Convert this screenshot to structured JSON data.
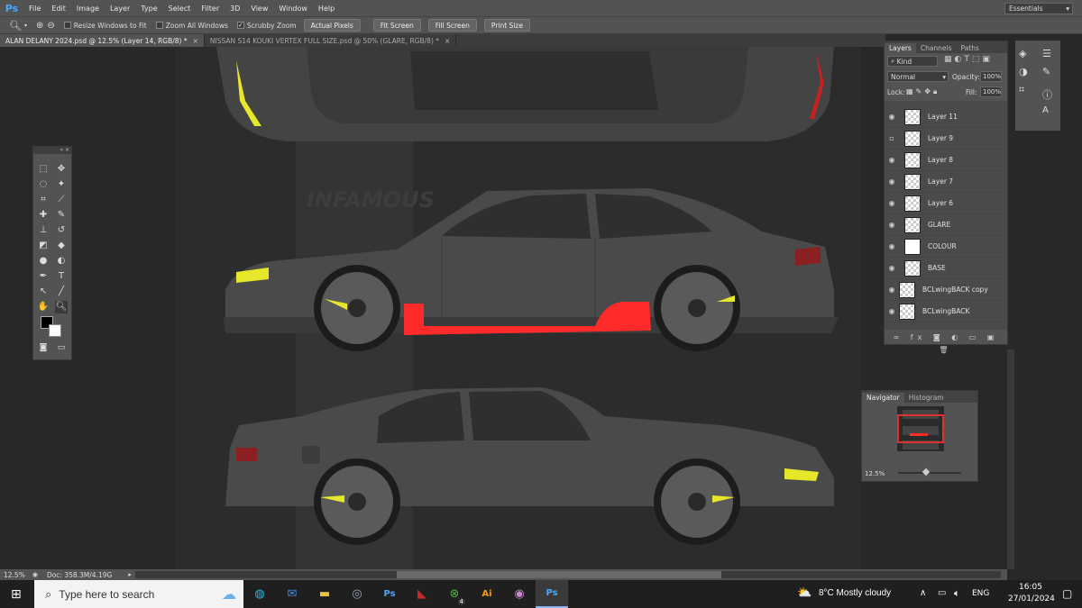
{
  "app": {
    "logo": "Ps"
  },
  "menu": [
    "File",
    "Edit",
    "Image",
    "Layer",
    "Type",
    "Select",
    "Filter",
    "3D",
    "View",
    "Window",
    "Help"
  ],
  "options": {
    "resize_windows": "Resize Windows to Fit",
    "zoom_all": "Zoom All Windows",
    "scrubby_zoom": "Scrubby Zoom",
    "actual_pixels": "Actual Pixels",
    "fit_screen": "Fit Screen",
    "fill_screen": "Fill Screen",
    "print_size": "Print Size",
    "workspace": "Essentials"
  },
  "tabs": [
    {
      "label": "ALAN DELANY 2024.psd @ 12.5% (Layer 14, RGB/8) *",
      "active": true
    },
    {
      "label": "NISSAN S14 KOUKI VERTEX FULL SIZE.psd @ 50% (GLARE, RGB/8) *",
      "active": false
    }
  ],
  "canvas": {
    "watermark": "INFAMOUS"
  },
  "layers_panel": {
    "tabs": [
      "Layers",
      "Channels",
      "Paths"
    ],
    "filter": "Kind",
    "blend_mode": "Normal",
    "opacity_label": "Opacity:",
    "opacity": "100%",
    "lock_label": "Lock:",
    "fill_label": "Fill:",
    "fill": "100%",
    "layers": [
      {
        "name": "Layer 11",
        "visible": true
      },
      {
        "name": "Layer 9",
        "visible": false
      },
      {
        "name": "Layer 8",
        "visible": true
      },
      {
        "name": "Layer 7",
        "visible": true
      },
      {
        "name": "Layer 6",
        "visible": true
      },
      {
        "name": "GLARE",
        "visible": true
      },
      {
        "name": "COLOUR",
        "visible": true
      },
      {
        "name": "BASE",
        "visible": true
      },
      {
        "name": "BCLwingBACK copy",
        "visible": true
      },
      {
        "name": "BCLwingBACK",
        "visible": true
      }
    ]
  },
  "navigator": {
    "tabs": [
      "Navigator",
      "Histogram"
    ],
    "zoom": "12.5%"
  },
  "status": {
    "zoom": "12.5%",
    "doc": "Doc: 358.3M/4.19G"
  },
  "taskbar": {
    "search_placeholder": "Type here to search",
    "weather": "8°C  Mostly cloudy",
    "lang": "ENG",
    "time": "16:05",
    "date": "27/01/2024",
    "xbox_badge": "4"
  },
  "colors": {
    "accent_red": "#ff2a2a",
    "caliper_yellow": "#e6e62a",
    "car_body": "#474747"
  }
}
